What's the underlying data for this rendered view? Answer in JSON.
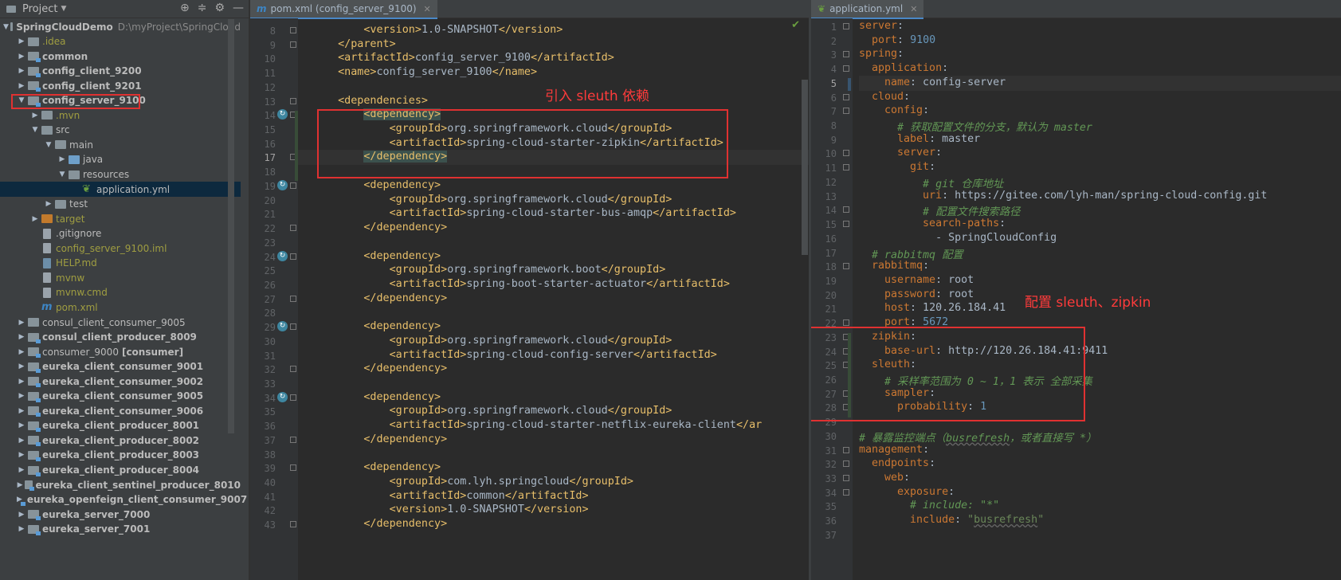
{
  "project": {
    "title": "Project",
    "tree": [
      {
        "label": "SpringCloudDemo",
        "extra": "D:\\myProject\\SpringCloud",
        "depth": 0,
        "arrow": "▼",
        "icon": "folder",
        "style": "b"
      },
      {
        "label": ".idea",
        "depth": 1,
        "arrow": "▶",
        "icon": "folder",
        "style": "y"
      },
      {
        "label": "common",
        "depth": 1,
        "arrow": "▶",
        "icon": "folder mod",
        "style": "b"
      },
      {
        "label": "config_client_9200",
        "depth": 1,
        "arrow": "▶",
        "icon": "folder mod",
        "style": "b"
      },
      {
        "label": "config_client_9201",
        "depth": 1,
        "arrow": "▶",
        "icon": "folder mod",
        "style": "b"
      },
      {
        "label": "config_server_9100",
        "depth": 1,
        "arrow": "▼",
        "icon": "folder mod",
        "style": "b"
      },
      {
        "label": ".mvn",
        "depth": 2,
        "arrow": "▶",
        "icon": "folder",
        "style": "y"
      },
      {
        "label": "src",
        "depth": 2,
        "arrow": "▼",
        "icon": "folder",
        "style": ""
      },
      {
        "label": "main",
        "depth": 3,
        "arrow": "▼",
        "icon": "folder",
        "style": ""
      },
      {
        "label": "java",
        "depth": 4,
        "arrow": "▶",
        "icon": "folder blue",
        "style": ""
      },
      {
        "label": "resources",
        "depth": 4,
        "arrow": "▼",
        "icon": "folder",
        "style": ""
      },
      {
        "label": "application.yml",
        "depth": 5,
        "arrow": "",
        "icon": "leaf",
        "style": "",
        "selected": true
      },
      {
        "label": "test",
        "depth": 3,
        "arrow": "▶",
        "icon": "folder",
        "style": ""
      },
      {
        "label": "target",
        "depth": 2,
        "arrow": "▶",
        "icon": "folder orange",
        "style": "y"
      },
      {
        "label": ".gitignore",
        "depth": 2,
        "arrow": "",
        "icon": "file",
        "style": ""
      },
      {
        "label": "config_server_9100.iml",
        "depth": 2,
        "arrow": "",
        "icon": "file",
        "style": "y"
      },
      {
        "label": "HELP.md",
        "depth": 2,
        "arrow": "",
        "icon": "file md",
        "style": "y"
      },
      {
        "label": "mvnw",
        "depth": 2,
        "arrow": "",
        "icon": "file",
        "style": "y"
      },
      {
        "label": "mvnw.cmd",
        "depth": 2,
        "arrow": "",
        "icon": "file",
        "style": "y"
      },
      {
        "label": "pom.xml",
        "depth": 2,
        "arrow": "",
        "icon": "mvn",
        "style": "y"
      },
      {
        "label": "consul_client_consumer_9005",
        "depth": 1,
        "arrow": "▶",
        "icon": "folder",
        "style": ""
      },
      {
        "label": "consul_client_producer_8009",
        "depth": 1,
        "arrow": "▶",
        "icon": "folder mod",
        "style": "b"
      },
      {
        "label": "consumer_9000",
        "extra2": "[consumer]",
        "depth": 1,
        "arrow": "▶",
        "icon": "folder mod",
        "style": ""
      },
      {
        "label": "eureka_client_consumer_9001",
        "depth": 1,
        "arrow": "▶",
        "icon": "folder mod",
        "style": "b"
      },
      {
        "label": "eureka_client_consumer_9002",
        "depth": 1,
        "arrow": "▶",
        "icon": "folder mod",
        "style": "b"
      },
      {
        "label": "eureka_client_consumer_9005",
        "depth": 1,
        "arrow": "▶",
        "icon": "folder mod",
        "style": "b"
      },
      {
        "label": "eureka_client_consumer_9006",
        "depth": 1,
        "arrow": "▶",
        "icon": "folder mod",
        "style": "b"
      },
      {
        "label": "eureka_client_producer_8001",
        "depth": 1,
        "arrow": "▶",
        "icon": "folder mod",
        "style": "b"
      },
      {
        "label": "eureka_client_producer_8002",
        "depth": 1,
        "arrow": "▶",
        "icon": "folder mod",
        "style": "b"
      },
      {
        "label": "eureka_client_producer_8003",
        "depth": 1,
        "arrow": "▶",
        "icon": "folder mod",
        "style": "b"
      },
      {
        "label": "eureka_client_producer_8004",
        "depth": 1,
        "arrow": "▶",
        "icon": "folder mod",
        "style": "b"
      },
      {
        "label": "eureka_client_sentinel_producer_8010",
        "depth": 1,
        "arrow": "▶",
        "icon": "folder mod",
        "style": "b"
      },
      {
        "label": "eureka_openfeign_client_consumer_9007",
        "depth": 1,
        "arrow": "▶",
        "icon": "folder mod",
        "style": "b"
      },
      {
        "label": "eureka_server_7000",
        "depth": 1,
        "arrow": "▶",
        "icon": "folder mod",
        "style": "b"
      },
      {
        "label": "eureka_server_7001",
        "depth": 1,
        "arrow": "▶",
        "icon": "folder mod",
        "style": "b"
      }
    ]
  },
  "pom": {
    "tab": "pom.xml (config_server_9100)",
    "tab_icon": "m",
    "annotation": "引入 sleuth 依赖",
    "first_line": 8,
    "lines": [
      [
        [
          "      ",
          "tx"
        ],
        [
          "<version>",
          "tg"
        ],
        [
          "1.0-SNAPSHOT",
          "tx"
        ],
        [
          "</version>",
          "tg"
        ]
      ],
      [
        [
          "  ",
          "tx"
        ],
        [
          "</parent>",
          "tg"
        ]
      ],
      [
        [
          "  ",
          "tx"
        ],
        [
          "<artifactId>",
          "tg"
        ],
        [
          "config_server_9100",
          "tx"
        ],
        [
          "</artifactId>",
          "tg"
        ]
      ],
      [
        [
          "  ",
          "tx"
        ],
        [
          "<name>",
          "tg"
        ],
        [
          "config_server_9100",
          "tx"
        ],
        [
          "</name>",
          "tg"
        ]
      ],
      [
        [
          "",
          "tx"
        ]
      ],
      [
        [
          "  ",
          "tx"
        ],
        [
          "<dependencies>",
          "tg"
        ]
      ],
      [
        [
          "      ",
          "tx"
        ],
        [
          "<dependency>",
          "tg box"
        ]
      ],
      [
        [
          "          ",
          "tx"
        ],
        [
          "<groupId>",
          "tg"
        ],
        [
          "org.springframework.cloud",
          "tx"
        ],
        [
          "</groupId>",
          "tg"
        ]
      ],
      [
        [
          "          ",
          "tx"
        ],
        [
          "<artifactId>",
          "tg"
        ],
        [
          "spring-cloud-starter-zipkin",
          "tx"
        ],
        [
          "</artifactId>",
          "tg"
        ]
      ],
      [
        [
          "      ",
          "tx"
        ],
        [
          "</dependency>",
          "tg box"
        ]
      ],
      [
        [
          "",
          "tx"
        ]
      ],
      [
        [
          "      ",
          "tx"
        ],
        [
          "<dependency>",
          "tg"
        ]
      ],
      [
        [
          "          ",
          "tx"
        ],
        [
          "<groupId>",
          "tg"
        ],
        [
          "org.springframework.cloud",
          "tx"
        ],
        [
          "</groupId>",
          "tg"
        ]
      ],
      [
        [
          "          ",
          "tx"
        ],
        [
          "<artifactId>",
          "tg"
        ],
        [
          "spring-cloud-starter-bus-amqp",
          "tx"
        ],
        [
          "</artifactId>",
          "tg"
        ]
      ],
      [
        [
          "      ",
          "tx"
        ],
        [
          "</dependency>",
          "tg"
        ]
      ],
      [
        [
          "",
          "tx"
        ]
      ],
      [
        [
          "      ",
          "tx"
        ],
        [
          "<dependency>",
          "tg"
        ]
      ],
      [
        [
          "          ",
          "tx"
        ],
        [
          "<groupId>",
          "tg"
        ],
        [
          "org.springframework.boot",
          "tx"
        ],
        [
          "</groupId>",
          "tg"
        ]
      ],
      [
        [
          "          ",
          "tx"
        ],
        [
          "<artifactId>",
          "tg"
        ],
        [
          "spring-boot-starter-actuator",
          "tx"
        ],
        [
          "</artifactId>",
          "tg"
        ]
      ],
      [
        [
          "      ",
          "tx"
        ],
        [
          "</dependency>",
          "tg"
        ]
      ],
      [
        [
          "",
          "tx"
        ]
      ],
      [
        [
          "      ",
          "tx"
        ],
        [
          "<dependency>",
          "tg"
        ]
      ],
      [
        [
          "          ",
          "tx"
        ],
        [
          "<groupId>",
          "tg"
        ],
        [
          "org.springframework.cloud",
          "tx"
        ],
        [
          "</groupId>",
          "tg"
        ]
      ],
      [
        [
          "          ",
          "tx"
        ],
        [
          "<artifactId>",
          "tg"
        ],
        [
          "spring-cloud-config-server",
          "tx"
        ],
        [
          "</artifactId>",
          "tg"
        ]
      ],
      [
        [
          "      ",
          "tx"
        ],
        [
          "</dependency>",
          "tg"
        ]
      ],
      [
        [
          "",
          "tx"
        ]
      ],
      [
        [
          "      ",
          "tx"
        ],
        [
          "<dependency>",
          "tg"
        ]
      ],
      [
        [
          "          ",
          "tx"
        ],
        [
          "<groupId>",
          "tg"
        ],
        [
          "org.springframework.cloud",
          "tx"
        ],
        [
          "</groupId>",
          "tg"
        ]
      ],
      [
        [
          "          ",
          "tx"
        ],
        [
          "<artifactId>",
          "tg"
        ],
        [
          "spring-cloud-starter-netflix-eureka-client",
          "tx"
        ],
        [
          "</ar",
          "tg"
        ]
      ],
      [
        [
          "      ",
          "tx"
        ],
        [
          "</dependency>",
          "tg"
        ]
      ],
      [
        [
          "",
          "tx"
        ]
      ],
      [
        [
          "      ",
          "tx"
        ],
        [
          "<dependency>",
          "tg"
        ]
      ],
      [
        [
          "          ",
          "tx"
        ],
        [
          "<groupId>",
          "tg"
        ],
        [
          "com.lyh.springcloud",
          "tx"
        ],
        [
          "</groupId>",
          "tg"
        ]
      ],
      [
        [
          "          ",
          "tx"
        ],
        [
          "<artifactId>",
          "tg"
        ],
        [
          "common",
          "tx"
        ],
        [
          "</artifactId>",
          "tg"
        ]
      ],
      [
        [
          "          ",
          "tx"
        ],
        [
          "<version>",
          "tg"
        ],
        [
          "1.0-SNAPSHOT",
          "tx"
        ],
        [
          "</version>",
          "tg"
        ]
      ],
      [
        [
          "      ",
          "tx"
        ],
        [
          "</dependency>",
          "tg"
        ]
      ]
    ]
  },
  "yml": {
    "tab": "application.yml",
    "annotation": "配置 sleuth、zipkin",
    "first_line": 1,
    "lines": [
      [
        [
          "server",
          "yk"
        ],
        [
          ":",
          "yv"
        ]
      ],
      [
        [
          "  port",
          "yk"
        ],
        [
          ": ",
          "yv"
        ],
        [
          "9100",
          "num"
        ]
      ],
      [
        [
          "spring",
          "yk"
        ],
        [
          ":",
          "yv"
        ]
      ],
      [
        [
          "  application",
          "yk"
        ],
        [
          ":",
          "yv"
        ]
      ],
      [
        [
          "    name",
          "yk"
        ],
        [
          ": config-server",
          "yv"
        ]
      ],
      [
        [
          "  cloud",
          "yk"
        ],
        [
          ":",
          "yv"
        ]
      ],
      [
        [
          "    config",
          "yk"
        ],
        [
          ":",
          "yv"
        ]
      ],
      [
        [
          "      # 获取配置文件的分支，默认为 master",
          "cm"
        ]
      ],
      [
        [
          "      label",
          "yk"
        ],
        [
          ": master",
          "yv"
        ]
      ],
      [
        [
          "      server",
          "yk"
        ],
        [
          ":",
          "yv"
        ]
      ],
      [
        [
          "        git",
          "yk"
        ],
        [
          ":",
          "yv"
        ]
      ],
      [
        [
          "          # git 仓库地址",
          "cm"
        ]
      ],
      [
        [
          "          uri",
          "yk"
        ],
        [
          ": https://gitee.com/lyh-man/spring-cloud-config.git",
          "yv"
        ]
      ],
      [
        [
          "          # 配置文件搜索路径",
          "cm"
        ]
      ],
      [
        [
          "          search-paths",
          "yk"
        ],
        [
          ":",
          "yv"
        ]
      ],
      [
        [
          "            - SpringCloudConfig",
          "yv"
        ]
      ],
      [
        [
          "  # rabbitmq 配置",
          "cm"
        ]
      ],
      [
        [
          "  rabbitmq",
          "yk"
        ],
        [
          ":",
          "yv"
        ]
      ],
      [
        [
          "    username",
          "yk"
        ],
        [
          ": root",
          "yv"
        ]
      ],
      [
        [
          "    password",
          "yk"
        ],
        [
          ": root",
          "yv"
        ]
      ],
      [
        [
          "    host",
          "yk"
        ],
        [
          ": 120.26.184.41",
          "yv"
        ]
      ],
      [
        [
          "    port",
          "yk"
        ],
        [
          ": ",
          "yv"
        ],
        [
          "5672",
          "num"
        ]
      ],
      [
        [
          "  zipkin",
          "yk"
        ],
        [
          ":",
          "yv"
        ]
      ],
      [
        [
          "    base-url",
          "yk"
        ],
        [
          ": http://120.26.184.41:9411",
          "yv"
        ]
      ],
      [
        [
          "  sleuth",
          "yk"
        ],
        [
          ":",
          "yv"
        ]
      ],
      [
        [
          "    # 采样率范围为 0 ~ 1，1 表示 全部采集",
          "cm"
        ]
      ],
      [
        [
          "    sampler",
          "yk"
        ],
        [
          ":",
          "yv"
        ]
      ],
      [
        [
          "      probability",
          "yk"
        ],
        [
          ": ",
          "yv"
        ],
        [
          "1",
          "num"
        ]
      ],
      [
        [
          "",
          "yv"
        ]
      ],
      [
        [
          "# 暴露监控端点（",
          "cm"
        ],
        [
          "busrefresh",
          "cm und"
        ],
        [
          "，或者直接写 *）",
          "cm"
        ]
      ],
      [
        [
          "management",
          "yk"
        ],
        [
          ":",
          "yv"
        ]
      ],
      [
        [
          "  endpoints",
          "yk"
        ],
        [
          ":",
          "yv"
        ]
      ],
      [
        [
          "    web",
          "yk"
        ],
        [
          ":",
          "yv"
        ]
      ],
      [
        [
          "      exposure",
          "yk"
        ],
        [
          ":",
          "yv"
        ]
      ],
      [
        [
          "        # include: \"*\"",
          "cm"
        ]
      ],
      [
        [
          "        include",
          "yk"
        ],
        [
          ": ",
          "yv"
        ],
        [
          "\"",
          "str"
        ],
        [
          "busrefresh",
          "str und"
        ],
        [
          "\"",
          "str"
        ]
      ],
      [
        [
          "",
          "yv"
        ]
      ]
    ]
  }
}
